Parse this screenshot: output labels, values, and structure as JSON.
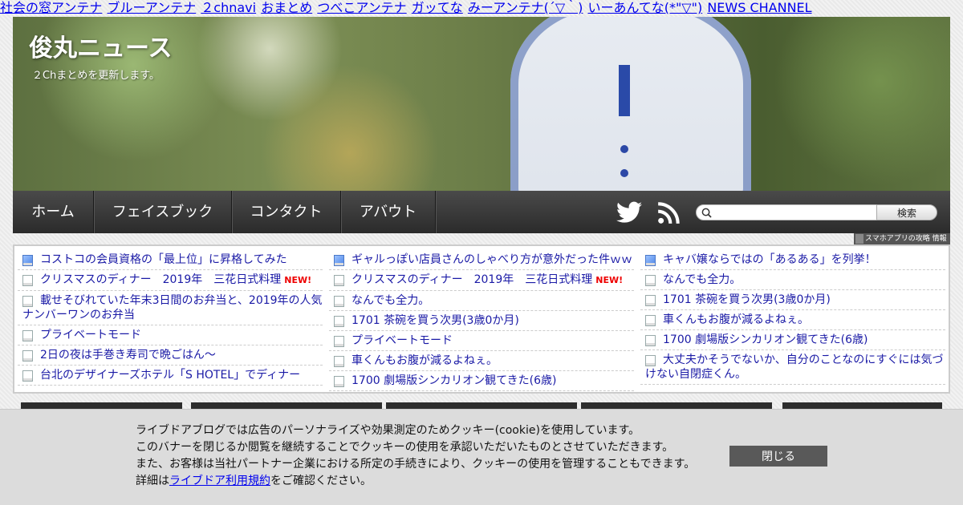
{
  "antenna_links": [
    "社会の窓アンテナ",
    "ブルーアンテナ",
    "２chnavi",
    "おまとめ",
    "つべこアンテナ",
    "ガッてな",
    "みーアンテナ(´▽｀)",
    "いーあんてな(*\"▽\")",
    "NEWS CHANNEL"
  ],
  "header": {
    "title": "俊丸ニュース",
    "subtitle": "２Chまとめを更新します。"
  },
  "nav": {
    "items": [
      "ホーム",
      "フェイスブック",
      "コンタクト",
      "アバウト"
    ],
    "search_placeholder": "",
    "search_button": "検索"
  },
  "app_info": "スマホアプリの攻略 情報",
  "feed": {
    "columns": [
      [
        {
          "title": "コストコの会員資格の「最上位」に昇格してみた",
          "new": false,
          "icon": "blue"
        },
        {
          "title": "クリスマスのディナー　2019年　三花日式料理",
          "new": true,
          "icon": "doc"
        },
        {
          "title": "載せそびれていた年末3日間のお弁当と、2019年の人気ナンバーワンのお弁当",
          "new": false,
          "icon": "doc"
        },
        {
          "title": "プライベートモード",
          "new": false,
          "icon": "doc"
        },
        {
          "title": "2日の夜は手巻き寿司で晩ごはん～",
          "new": false,
          "icon": "doc"
        },
        {
          "title": "台北のデザイナーズホテル「S HOTEL」でディナー",
          "new": false,
          "icon": "doc"
        }
      ],
      [
        {
          "title": "ギャルっぽい店員さんのしゃべり方が意外だった件ｗｗ",
          "new": false,
          "icon": "blue"
        },
        {
          "title": "クリスマスのディナー　2019年　三花日式料理",
          "new": true,
          "icon": "doc"
        },
        {
          "title": "なんでも全力。",
          "new": false,
          "icon": "doc"
        },
        {
          "title": "1701 茶碗を買う次男(3歳0か月)",
          "new": false,
          "icon": "doc"
        },
        {
          "title": "プライベートモード",
          "new": false,
          "icon": "doc"
        },
        {
          "title": "車くんもお腹が減るよねぇ。",
          "new": false,
          "icon": "doc"
        },
        {
          "title": "1700 劇場版シンカリオン観てきた(6歳)",
          "new": false,
          "icon": "doc"
        }
      ],
      [
        {
          "title": "キャバ嬢ならではの「あるある」を列挙！",
          "new": false,
          "icon": "blue"
        },
        {
          "title": "なんでも全力。",
          "new": false,
          "icon": "doc"
        },
        {
          "title": "1701 茶碗を買う次男(3歳0か月)",
          "new": false,
          "icon": "doc"
        },
        {
          "title": "車くんもお腹が減るよねぇ。",
          "new": false,
          "icon": "doc"
        },
        {
          "title": "1700 劇場版シンカリオン観てきた(6歳)",
          "new": false,
          "icon": "doc"
        },
        {
          "title": "大丈夫かそうでないか、自分のことなのにすぐには気づけない自閉症くん。",
          "new": false,
          "icon": "doc"
        }
      ]
    ],
    "new_label": "NEW!"
  },
  "cookie": {
    "line1": "ライブドアブログでは広告のパーソナライズや効果測定のためクッキー(cookie)を使用しています。",
    "line2": "このバナーを閉じるか閲覧を継続することでクッキーの使用を承認いただいたものとさせていただきます。",
    "line3": "また、お客様は当社パートナー企業における所定の手続きにより、クッキーの使用を管理することもできます。",
    "line4_prefix": "詳細は",
    "line4_link": "ライブドア利用規約",
    "line4_suffix": "をご確認ください。",
    "close_label": "閉じる"
  }
}
